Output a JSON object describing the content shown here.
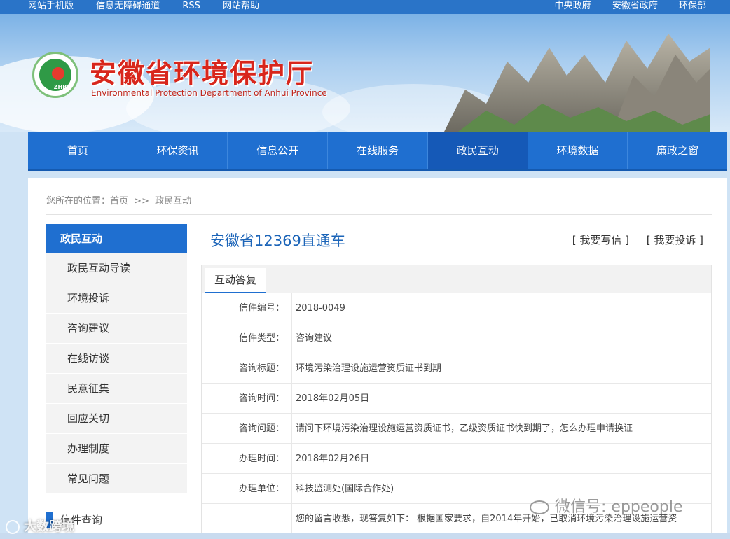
{
  "topbar": {
    "left": [
      "网站手机版",
      "信息无障碍通道",
      "RSS",
      "网站帮助"
    ],
    "right": [
      "中央政府",
      "安徽省政府",
      "环保部"
    ]
  },
  "header": {
    "logo_text": "ZHB",
    "title": "安徽省环境保护厅",
    "subtitle": "Environmental Protection Department of Anhui Province"
  },
  "nav": [
    "首页",
    "环保资讯",
    "信息公开",
    "在线服务",
    "政民互动",
    "环境数据",
    "廉政之窗"
  ],
  "nav_active": "政民互动",
  "breadcrumb": {
    "prefix": "您所在的位置：",
    "home": "首页",
    "sep": ">>",
    "current": "政民互动"
  },
  "sidebar": {
    "title": "政民互动",
    "items": [
      "政民互动导读",
      "环境投诉",
      "咨询建议",
      "在线访谈",
      "民意征集",
      "回应关切",
      "办理制度",
      "常见问题"
    ],
    "extra": "信件查询"
  },
  "main": {
    "title": "安徽省12369直通车",
    "actions": [
      "[ 我要写信 ]",
      "[ 我要投诉 ]"
    ],
    "tab": "互动答复",
    "rows": [
      {
        "k": "信件编号：",
        "v": "2018-0049"
      },
      {
        "k": "信件类型：",
        "v": "咨询建议"
      },
      {
        "k": "咨询标题：",
        "v": "环境污染治理设施运营资质证书到期"
      },
      {
        "k": "咨询时间：",
        "v": "2018年02月05日"
      },
      {
        "k": "咨询问题：",
        "v": "请问下环境污染治理设施运营资质证书，乙级资质证书快到期了，怎么办理申请换证"
      },
      {
        "k": "办理时间：",
        "v": "2018年02月26日"
      },
      {
        "k": "办理单位：",
        "v": "科技监测处(国际合作处)"
      },
      {
        "k": "",
        "v": "您的留言收悉，现答复如下： 根据国家要求，自2014年开始，已取消环境污染治理设施运营资"
      }
    ]
  },
  "watermarks": {
    "wechat": "微信号: eppeople",
    "brand": "大数跨境"
  },
  "colors": {
    "nav_blue": "#1f6fd0",
    "title_red": "#d8261c",
    "title_blue": "#1b64b8"
  }
}
